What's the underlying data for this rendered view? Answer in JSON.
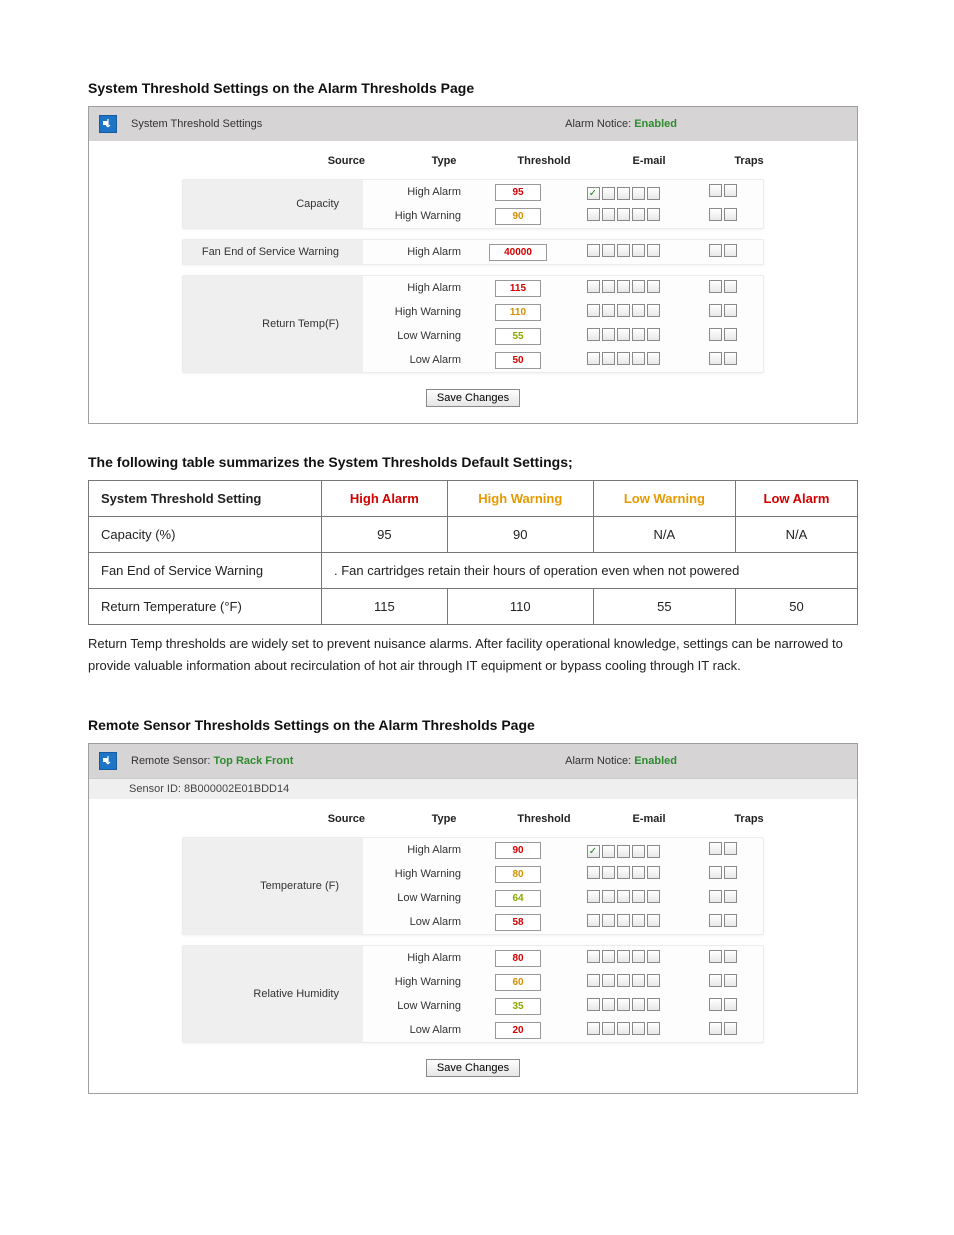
{
  "section1": {
    "heading": "System Threshold Settings on the Alarm Thresholds Page",
    "panel_title": "System Threshold Settings",
    "notice_label": "Alarm Notice:",
    "notice_value": "Enabled",
    "cols": {
      "source": "Source",
      "type": "Type",
      "threshold": "Threshold",
      "email": "E-mail",
      "traps": "Traps"
    },
    "groups": [
      {
        "source": "Capacity",
        "rows": [
          {
            "type": "High Alarm",
            "value": "95",
            "cls": "v-high-alarm",
            "email": [
              true,
              false,
              false,
              false,
              false
            ],
            "traps": [
              false,
              false
            ]
          },
          {
            "type": "High Warning",
            "value": "90",
            "cls": "v-high-warn",
            "email": [
              false,
              false,
              false,
              false,
              false
            ],
            "traps": [
              false,
              false
            ]
          }
        ]
      },
      {
        "source": "Fan End of Service Warning",
        "rows": [
          {
            "type": "High Alarm",
            "value": "40000",
            "cls": "v-high-alarm",
            "wide": true,
            "email": [
              false,
              false,
              false,
              false,
              false
            ],
            "traps": [
              false,
              false
            ]
          }
        ]
      },
      {
        "source": "Return Temp(F)",
        "rows": [
          {
            "type": "High Alarm",
            "value": "115",
            "cls": "v-high-alarm",
            "email": [
              false,
              false,
              false,
              false,
              false
            ],
            "traps": [
              false,
              false
            ]
          },
          {
            "type": "High Warning",
            "value": "110",
            "cls": "v-high-warn",
            "email": [
              false,
              false,
              false,
              false,
              false
            ],
            "traps": [
              false,
              false
            ]
          },
          {
            "type": "Low Warning",
            "value": "55",
            "cls": "v-low-warn",
            "email": [
              false,
              false,
              false,
              false,
              false
            ],
            "traps": [
              false,
              false
            ]
          },
          {
            "type": "Low Alarm",
            "value": "50",
            "cls": "v-low-alarm",
            "email": [
              false,
              false,
              false,
              false,
              false
            ],
            "traps": [
              false,
              false
            ]
          }
        ]
      }
    ],
    "save": "Save Changes"
  },
  "defaults": {
    "heading": "The following table summarizes the System Thresholds Default Settings;",
    "headers": {
      "setting": "System Threshold Setting",
      "ha": "High Alarm",
      "hw": "High Warning",
      "lw": "Low Warning",
      "la": "Low Alarm"
    },
    "rows": [
      {
        "setting": "Capacity (%)",
        "ha": "95",
        "hw": "90",
        "lw": "N/A",
        "la": "N/A"
      },
      {
        "setting": "Fan End of Service Warning",
        "span": ". Fan cartridges retain their hours of operation even when not powered"
      },
      {
        "setting": "Return Temperature (°F)",
        "ha": "115",
        "hw": "110",
        "lw": "55",
        "la": "50"
      }
    ],
    "note": "Return Temp thresholds are widely set to prevent nuisance alarms. After facility operational knowledge, settings can be narrowed to provide valuable information about recirculation of hot air through IT equipment or bypass cooling through IT rack."
  },
  "section2": {
    "heading": "Remote Sensor Thresholds Settings on the Alarm Thresholds Page",
    "panel_title_prefix": "Remote Sensor:",
    "panel_sensor": "Top Rack Front",
    "notice_label": "Alarm Notice:",
    "notice_value": "Enabled",
    "sensor_id_label": "Sensor ID:",
    "sensor_id": "8B000002E01BDD14",
    "cols": {
      "source": "Source",
      "type": "Type",
      "threshold": "Threshold",
      "email": "E-mail",
      "traps": "Traps"
    },
    "groups": [
      {
        "source": "Temperature (F)",
        "rows": [
          {
            "type": "High Alarm",
            "value": "90",
            "cls": "v-high-alarm",
            "email": [
              true,
              false,
              false,
              false,
              false
            ],
            "traps": [
              false,
              false
            ]
          },
          {
            "type": "High Warning",
            "value": "80",
            "cls": "v-high-warn",
            "email": [
              false,
              false,
              false,
              false,
              false
            ],
            "traps": [
              false,
              false
            ]
          },
          {
            "type": "Low Warning",
            "value": "64",
            "cls": "v-low-warn",
            "email": [
              false,
              false,
              false,
              false,
              false
            ],
            "traps": [
              false,
              false
            ]
          },
          {
            "type": "Low Alarm",
            "value": "58",
            "cls": "v-low-alarm",
            "email": [
              false,
              false,
              false,
              false,
              false
            ],
            "traps": [
              false,
              false
            ]
          }
        ]
      },
      {
        "source": "Relative Humidity",
        "rows": [
          {
            "type": "High Alarm",
            "value": "80",
            "cls": "v-high-alarm",
            "email": [
              false,
              false,
              false,
              false,
              false
            ],
            "traps": [
              false,
              false
            ]
          },
          {
            "type": "High Warning",
            "value": "60",
            "cls": "v-high-warn",
            "email": [
              false,
              false,
              false,
              false,
              false
            ],
            "traps": [
              false,
              false
            ]
          },
          {
            "type": "Low Warning",
            "value": "35",
            "cls": "v-low-warn",
            "email": [
              false,
              false,
              false,
              false,
              false
            ],
            "traps": [
              false,
              false
            ]
          },
          {
            "type": "Low Alarm",
            "value": "20",
            "cls": "v-low-alarm",
            "email": [
              false,
              false,
              false,
              false,
              false
            ],
            "traps": [
              false,
              false
            ]
          }
        ]
      }
    ],
    "save": "Save Changes"
  }
}
